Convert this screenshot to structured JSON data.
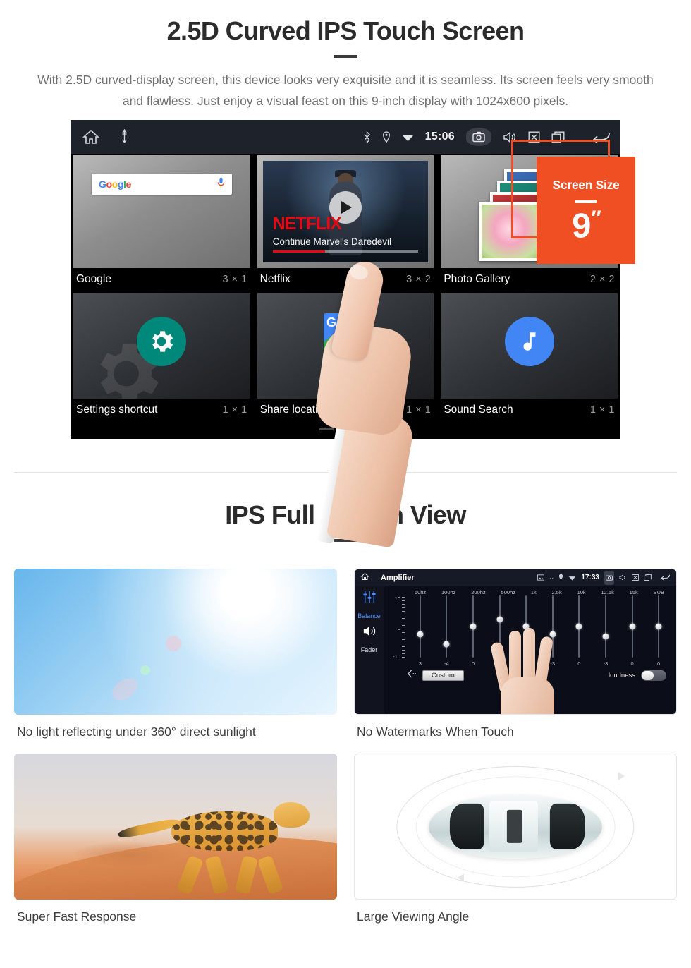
{
  "section1": {
    "title": "2.5D Curved IPS Touch Screen",
    "description": "With 2.5D curved-display screen, this device looks very exquisite and it is seamless. Its screen feels very smooth and flawless. Just enjoy a visual feast on this 9-inch display with 1024x600 pixels."
  },
  "device": {
    "statusbar": {
      "home_icon": "home-icon",
      "usb_icon": "usb-icon",
      "bluetooth_icon": "bluetooth-icon",
      "location_icon": "location-pin-icon",
      "wifi_icon": "wifi-icon",
      "time": "15:06",
      "camera_icon": "camera-icon",
      "volume_icon": "volume-icon",
      "close_icon": "close-box-icon",
      "recents_icon": "recents-icon",
      "back_icon": "back-arrow-icon"
    },
    "widgets": [
      {
        "label": "Google",
        "size": "3 × 1",
        "search_placeholder": "",
        "brand": "Google",
        "mic_icon": "microphone-icon"
      },
      {
        "label": "Netflix",
        "size": "3 × 2",
        "brand": "NETFLIX",
        "subtitle": "Continue Marvel's Daredevil",
        "play_icon": "play-icon"
      },
      {
        "label": "Photo Gallery",
        "size": "2 × 2"
      },
      {
        "label": "Settings shortcut",
        "size": "1 × 1",
        "icon": "gear-icon"
      },
      {
        "label": "Share location",
        "size": "1 × 1",
        "icon": "maps-location-icon"
      },
      {
        "label": "Sound Search",
        "size": "1 × 1",
        "icon": "music-note-icon"
      }
    ],
    "badge": {
      "title": "Screen Size",
      "value": "9",
      "unit": "″",
      "color": "#F04E23"
    }
  },
  "section2": {
    "title": "IPS Full Screen View",
    "features": [
      {
        "caption": "No light reflecting under 360° direct sunlight",
        "media": "sunlight-photo"
      },
      {
        "caption": "No Watermarks When Touch",
        "media": "amplifier-screenshot"
      },
      {
        "caption": "Super Fast Response",
        "media": "cheetah-photo"
      },
      {
        "caption": "Large Viewing Angle",
        "media": "car-top-view"
      }
    ]
  },
  "amplifier": {
    "title": "Amplifier",
    "time": "17:33",
    "sidebar": [
      {
        "label": "Balance",
        "icon": "sliders-icon"
      },
      {
        "label": "Fader",
        "icon": "speaker-icon"
      }
    ],
    "bands": [
      "60hz",
      "100hz",
      "200hz",
      "500hz",
      "1k",
      "2.5k",
      "10k",
      "12.5k",
      "15k",
      "SUB"
    ],
    "values": [
      3,
      -4,
      0,
      0,
      0,
      -3,
      0,
      -3,
      0,
      0
    ],
    "y_axis": [
      "10",
      "0",
      "-10"
    ],
    "preset_label": "Custom",
    "loudness_label": "loudness",
    "loudness_on": false,
    "back_icon": "back-chevron-icon"
  }
}
